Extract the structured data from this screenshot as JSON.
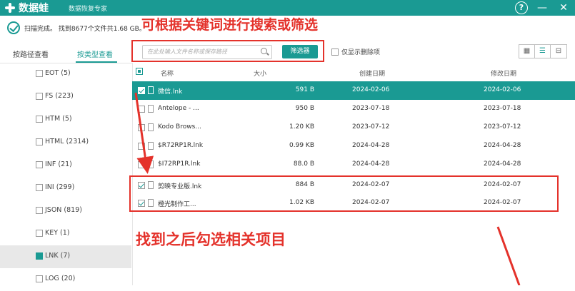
{
  "app": {
    "logo_text": "数据蛙",
    "subtitle": "数据恢复专家",
    "help_symbol": "?",
    "minimize_symbol": "—",
    "close_symbol": "✕"
  },
  "status": {
    "scan_text": "扫描完成。 找到8677个文件共1.68 GB。"
  },
  "annotations": {
    "top": "可根据关键词进行搜索或筛选",
    "middle": "找到之后勾选相关项目"
  },
  "side_tabs": {
    "by_path": "按路径查看",
    "by_type": "按类型查看"
  },
  "sidebar": {
    "items": [
      {
        "label": "EOT (5)",
        "active": false
      },
      {
        "label": "FS (223)",
        "active": false
      },
      {
        "label": "HTM (5)",
        "active": false
      },
      {
        "label": "HTML (2314)",
        "active": false
      },
      {
        "label": "INF (21)",
        "active": false
      },
      {
        "label": "INI (299)",
        "active": false
      },
      {
        "label": "JSON (819)",
        "active": false
      },
      {
        "label": "KEY (1)",
        "active": false
      },
      {
        "label": "LNK (7)",
        "active": true
      },
      {
        "label": "LOG (20)",
        "active": false
      }
    ]
  },
  "search": {
    "placeholder": "在此处输入文件名称或保存路径",
    "filter_button": "筛选器",
    "only_deleted_label": "仅显示删除项"
  },
  "view_buttons": [
    "▦",
    "☰",
    "⊟"
  ],
  "table": {
    "headers": {
      "name": "名称",
      "size": "大小",
      "created": "创建日期",
      "modified": "修改日期"
    },
    "rows": [
      {
        "name": "微信.lnk",
        "size": "591  B",
        "created": "2024-02-06",
        "modified": "2024-02-06",
        "checked": true,
        "selected": true
      },
      {
        "name": "Antelope - ...",
        "size": "950  B",
        "created": "2023-07-18",
        "modified": "2023-07-18",
        "checked": false,
        "selected": false
      },
      {
        "name": "Kodo Brows...",
        "size": "1.20 KB",
        "created": "2023-07-12",
        "modified": "2023-07-12",
        "checked": false,
        "selected": false
      },
      {
        "name": "$R72RP1R.lnk",
        "size": "0.99 KB",
        "created": "2024-04-28",
        "modified": "2024-04-28",
        "checked": false,
        "selected": false
      },
      {
        "name": "$I72RP1R.lnk",
        "size": "88.0  B",
        "created": "2024-04-28",
        "modified": "2024-04-28",
        "checked": false,
        "selected": false
      },
      {
        "name": "剪映专业版.lnk",
        "size": "884  B",
        "created": "2024-02-07",
        "modified": "2024-02-07",
        "checked": true,
        "selected": false
      },
      {
        "name": "橙光制作工...",
        "size": "1.02 KB",
        "created": "2024-02-07",
        "modified": "2024-02-07",
        "checked": true,
        "selected": false
      }
    ]
  },
  "colors": {
    "accent": "#1a9a93",
    "annotation": "#e4322b"
  }
}
